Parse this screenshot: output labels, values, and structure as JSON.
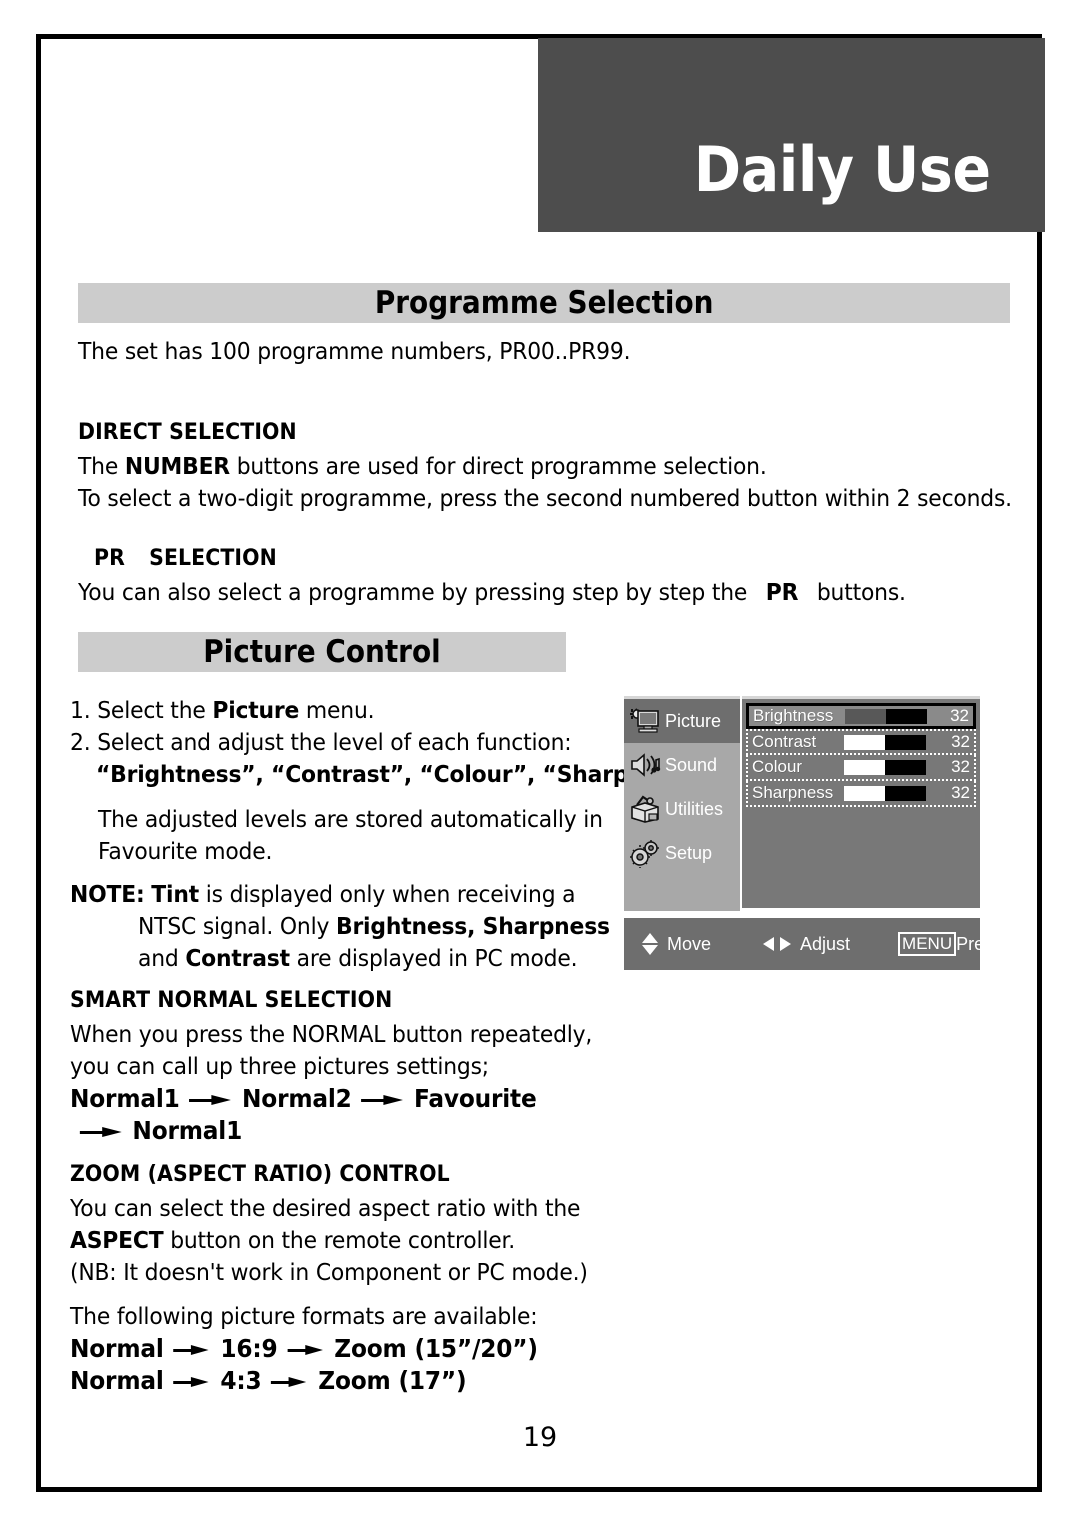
{
  "chapter": {
    "title": "Daily Use"
  },
  "page": {
    "number": "19"
  },
  "sections": {
    "programme_selection": {
      "heading": "Programme Selection",
      "intro": "The set has 100 programme numbers, PR00..PR99.",
      "direct_selection": {
        "heading": "DIRECT SELECTION",
        "line1_pre": "The ",
        "line1_bold": "NUMBER",
        "line1_post": " buttons are used for direct programme selection.",
        "line2": "To select  a two-digit programme, press the second numbered button within 2 seconds."
      },
      "pr_selection": {
        "heading_pr": "PR",
        "heading_selection": "SELECTION",
        "line_pre": "You can also select a programme by pressing step by step the",
        "line_bold": "PR",
        "line_post": "buttons."
      }
    },
    "picture_control": {
      "heading": "Picture Control",
      "step1_pre": "1. Select the ",
      "step1_bold": "Picture",
      "step1_post": " menu.",
      "step2": "2. Select and adjust the level of each function:",
      "step2_bold": "“Brightness”, “Contrast”, “Colour”, “Sharpness”.",
      "stored_line1": "The adjusted levels are stored automatically in",
      "stored_line2": "Favourite mode.",
      "note_label": "NOTE:",
      "note_tint": "Tint",
      "note_line1_rest": " is displayed only when receiving a",
      "note_line2_pre": "NTSC signal. Only ",
      "note_line2_bold": "Brightness, Sharpness",
      "note_line3_pre": "and ",
      "note_line3_bold": "Contrast",
      "note_line3_post": " are displayed in PC mode."
    },
    "smart_normal": {
      "heading": "SMART NORMAL SELECTION",
      "line1": "When you press the NORMAL button repeatedly,",
      "line2": "you can call up three pictures settings;",
      "flow": [
        "Normal1",
        "Normal2",
        "Favourite",
        "Normal1"
      ]
    },
    "zoom_control": {
      "heading": "ZOOM (ASPECT RATIO) CONTROL",
      "line1": "You can select the desired aspect ratio with the",
      "line2_bold": "ASPECT",
      "line2_rest": " button on the remote controller.",
      "line3": "(NB: It doesn't work in Component or PC mode.)",
      "formats_intro": "The following picture formats are available:",
      "flow_a": [
        "Normal",
        "16:9",
        "Zoom (15”/20”)"
      ],
      "flow_b": [
        "Normal",
        "4:3",
        "Zoom (17”)"
      ]
    }
  },
  "osd": {
    "nav": [
      {
        "label": "Picture",
        "icon": "picture-monitor-icon",
        "active": true
      },
      {
        "label": "Sound",
        "icon": "speaker-icon",
        "active": false
      },
      {
        "label": "Utilities",
        "icon": "toolbox-icon",
        "active": false
      },
      {
        "label": "Setup",
        "icon": "gears-icon",
        "active": false
      }
    ],
    "rows": [
      {
        "label": "Brightness",
        "value": "32",
        "fill_pct": 50,
        "selected": true
      },
      {
        "label": "Contrast",
        "value": "32",
        "fill_pct": 50,
        "selected": false
      },
      {
        "label": "Colour",
        "value": "32",
        "fill_pct": 50,
        "selected": false
      },
      {
        "label": "Sharpness",
        "value": "32",
        "fill_pct": 50,
        "selected": false
      }
    ],
    "footer": {
      "move": "Move",
      "adjust": "Adjust",
      "menu_key": "MENU",
      "prev": "Prev."
    }
  },
  "colors": {
    "chapter_header_bg": "#4d4d4d",
    "section_bar_bg": "#cccccc",
    "osd_sidebar_bg": "#a8a8a8",
    "osd_panel_bg": "#787878",
    "osd_active_bg": "#6e6e6e",
    "text": "#000000"
  }
}
